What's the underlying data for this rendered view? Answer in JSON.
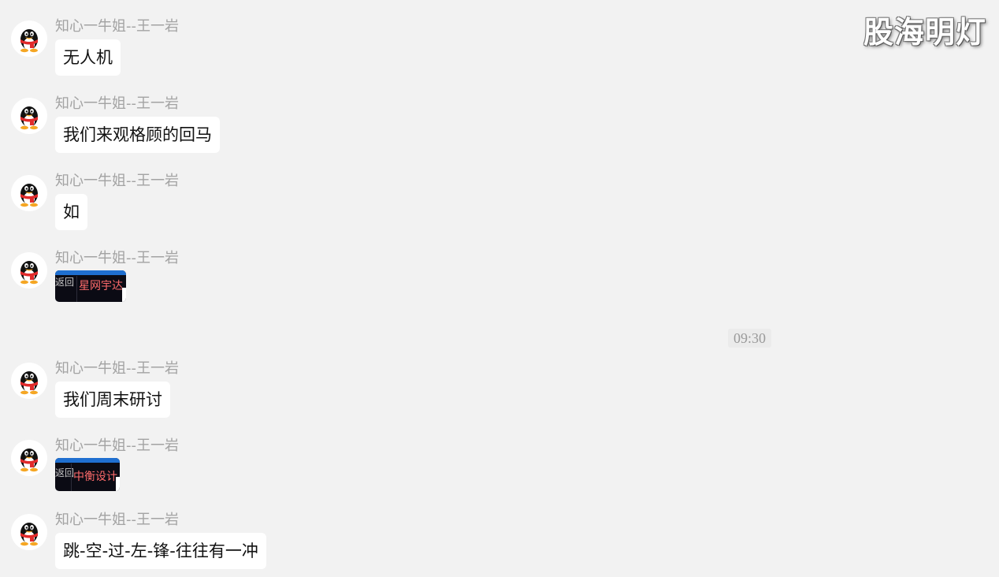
{
  "watermark": "股海明灯",
  "timestamp": "09:30",
  "messages": [
    {
      "sender": "知心一牛姐--王一岩",
      "text": "无人机"
    },
    {
      "sender": "知心一牛姐--王一岩",
      "text": "我们来观格顾的回马"
    },
    {
      "sender": "知心一牛姐--王一岩",
      "text": "如"
    },
    {
      "sender": "知心一牛姐--王一岩",
      "image": {
        "back": "返回",
        "title": "星网宇达"
      }
    },
    {
      "sender": "知心一牛姐--王一岩",
      "text": "我们周末研讨"
    },
    {
      "sender": "知心一牛姐--王一岩",
      "image": {
        "back": "返回",
        "title": "中衡设计"
      }
    },
    {
      "sender": "知心一牛姐--王一岩",
      "text": "跳-空-过-左-锋-往往有一冲"
    }
  ],
  "colors": {
    "background": "#f2f2f2",
    "bubble": "#ffffff",
    "sender": "#a3a3a3",
    "thumbnail_bar": "#1f6fd0",
    "thumbnail_title": "#ff6b6b"
  },
  "icons": {
    "avatar": "qq-penguin-icon"
  }
}
